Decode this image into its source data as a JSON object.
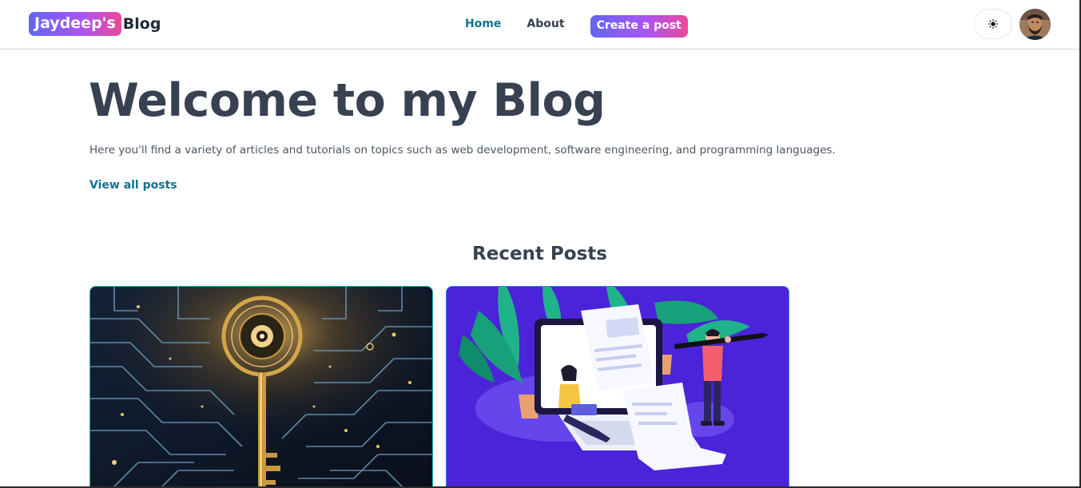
{
  "header": {
    "logo_badge": "Jaydeep's",
    "logo_text": "Blog",
    "nav": {
      "home": "Home",
      "about": "About",
      "create": "Create a post"
    },
    "theme_toggle_icon": "sun-icon"
  },
  "hero": {
    "title": "Welcome to my Blog",
    "description": "Here you'll find a variety of articles and tutorials on topics such as web development, software engineering, and programming languages.",
    "view_all": "View all posts"
  },
  "recent": {
    "title": "Recent Posts",
    "cards": [
      {
        "image": "circuit-key-image"
      },
      {
        "image": "writing-illustration-image"
      }
    ]
  },
  "colors": {
    "accent": "#0e7490",
    "gradient_start": "#6366f1",
    "gradient_mid": "#a855f7",
    "gradient_end": "#ec4899",
    "heading": "#374151"
  }
}
